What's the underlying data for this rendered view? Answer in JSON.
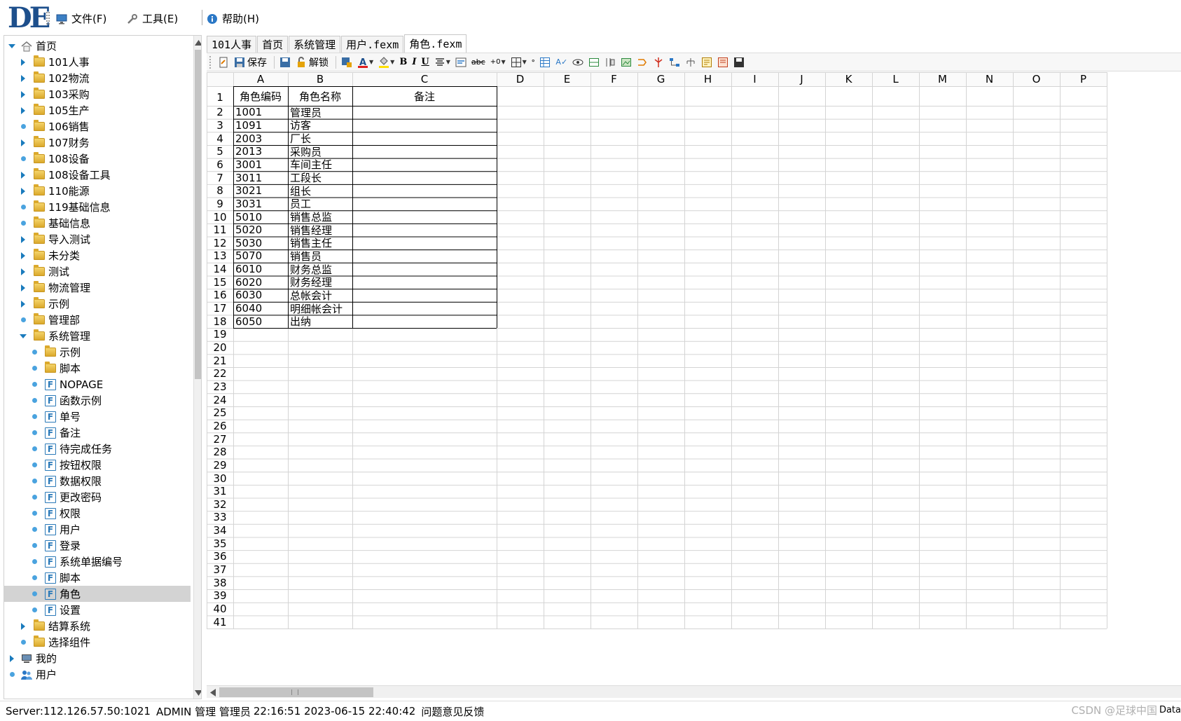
{
  "app": {
    "logo_text": "DE",
    "menu": [
      {
        "label": "文件(F)",
        "icon": "monitor-icon"
      },
      {
        "label": "工具(E)",
        "icon": "wrench-icon"
      },
      {
        "label": "帮助(H)",
        "icon": "info-icon"
      }
    ]
  },
  "tree": {
    "items": [
      {
        "label": "首页",
        "depth": 0,
        "toggle": "expanded",
        "icon": "home-icon"
      },
      {
        "label": "101人事",
        "depth": 1,
        "toggle": "collapsed",
        "icon": "folder-icon"
      },
      {
        "label": "102物流",
        "depth": 1,
        "toggle": "collapsed",
        "icon": "folder-icon"
      },
      {
        "label": "103采购",
        "depth": 1,
        "toggle": "collapsed",
        "icon": "folder-icon"
      },
      {
        "label": "105生产",
        "depth": 1,
        "toggle": "collapsed",
        "icon": "folder-icon"
      },
      {
        "label": "106销售",
        "depth": 1,
        "toggle": "leaf",
        "icon": "folder-icon"
      },
      {
        "label": "107财务",
        "depth": 1,
        "toggle": "collapsed",
        "icon": "folder-icon"
      },
      {
        "label": "108设备",
        "depth": 1,
        "toggle": "leaf",
        "icon": "folder-icon"
      },
      {
        "label": "108设备工具",
        "depth": 1,
        "toggle": "collapsed",
        "icon": "folder-icon"
      },
      {
        "label": "110能源",
        "depth": 1,
        "toggle": "collapsed",
        "icon": "folder-icon"
      },
      {
        "label": "119基础信息",
        "depth": 1,
        "toggle": "leaf",
        "icon": "folder-icon"
      },
      {
        "label": "基础信息",
        "depth": 1,
        "toggle": "leaf",
        "icon": "folder-icon"
      },
      {
        "label": "导入测试",
        "depth": 1,
        "toggle": "collapsed",
        "icon": "folder-icon"
      },
      {
        "label": "未分类",
        "depth": 1,
        "toggle": "collapsed",
        "icon": "folder-icon"
      },
      {
        "label": "测试",
        "depth": 1,
        "toggle": "collapsed",
        "icon": "folder-icon"
      },
      {
        "label": "物流管理",
        "depth": 1,
        "toggle": "collapsed",
        "icon": "folder-icon"
      },
      {
        "label": "示例",
        "depth": 1,
        "toggle": "collapsed",
        "icon": "folder-icon"
      },
      {
        "label": "管理部",
        "depth": 1,
        "toggle": "leaf",
        "icon": "folder-icon"
      },
      {
        "label": "系统管理",
        "depth": 1,
        "toggle": "expanded",
        "icon": "folder-icon"
      },
      {
        "label": "示例",
        "depth": 2,
        "toggle": "leaf",
        "icon": "folder-icon"
      },
      {
        "label": "脚本",
        "depth": 2,
        "toggle": "leaf",
        "icon": "folder-icon"
      },
      {
        "label": "NOPAGE",
        "depth": 2,
        "toggle": "leaf",
        "icon": "form-icon"
      },
      {
        "label": "函数示例",
        "depth": 2,
        "toggle": "leaf",
        "icon": "form-icon"
      },
      {
        "label": "单号",
        "depth": 2,
        "toggle": "leaf",
        "icon": "form-icon"
      },
      {
        "label": "备注",
        "depth": 2,
        "toggle": "leaf",
        "icon": "form-icon"
      },
      {
        "label": "待完成任务",
        "depth": 2,
        "toggle": "leaf",
        "icon": "form-icon"
      },
      {
        "label": "按钮权限",
        "depth": 2,
        "toggle": "leaf",
        "icon": "form-icon"
      },
      {
        "label": "数据权限",
        "depth": 2,
        "toggle": "leaf",
        "icon": "form-icon"
      },
      {
        "label": "更改密码",
        "depth": 2,
        "toggle": "leaf",
        "icon": "form-icon"
      },
      {
        "label": "权限",
        "depth": 2,
        "toggle": "leaf",
        "icon": "form-icon"
      },
      {
        "label": "用户",
        "depth": 2,
        "toggle": "leaf",
        "icon": "form-icon"
      },
      {
        "label": "登录",
        "depth": 2,
        "toggle": "leaf",
        "icon": "form-icon"
      },
      {
        "label": "系统单据编号",
        "depth": 2,
        "toggle": "leaf",
        "icon": "form-icon"
      },
      {
        "label": "脚本",
        "depth": 2,
        "toggle": "leaf",
        "icon": "form-icon"
      },
      {
        "label": "角色",
        "depth": 2,
        "toggle": "leaf",
        "icon": "form-icon",
        "selected": true
      },
      {
        "label": "设置",
        "depth": 2,
        "toggle": "leaf",
        "icon": "form-icon"
      },
      {
        "label": "结算系统",
        "depth": 1,
        "toggle": "collapsed",
        "icon": "folder-icon"
      },
      {
        "label": "选择组件",
        "depth": 1,
        "toggle": "leaf",
        "icon": "folder-icon"
      },
      {
        "label": "我的",
        "depth": 0,
        "toggle": "collapsed",
        "icon": "computer-icon"
      },
      {
        "label": "用户",
        "depth": 0,
        "toggle": "leaf",
        "icon": "users-icon"
      }
    ]
  },
  "tabs": [
    {
      "label": "101人事",
      "active": false
    },
    {
      "label": "首页",
      "active": false
    },
    {
      "label": "系统管理",
      "active": false
    },
    {
      "label": "用户.fexm",
      "active": false
    },
    {
      "label": "角色.fexm",
      "active": true
    }
  ],
  "toolbar": {
    "save_label": "保存",
    "unlock_label": "解锁"
  },
  "sheet": {
    "columns": [
      "A",
      "B",
      "C",
      "D",
      "E",
      "F",
      "G",
      "H",
      "I",
      "J",
      "K",
      "L",
      "M",
      "N",
      "O",
      "P"
    ],
    "row_count": 41,
    "header_row": [
      "角色编码",
      "角色名称",
      "备注"
    ],
    "rows": [
      [
        "1001",
        "管理员",
        ""
      ],
      [
        "1091",
        "访客",
        ""
      ],
      [
        "2003",
        "厂长",
        ""
      ],
      [
        "2013",
        "采购员",
        ""
      ],
      [
        "3001",
        "车间主任",
        ""
      ],
      [
        "3011",
        "工段长",
        ""
      ],
      [
        "3021",
        "组长",
        ""
      ],
      [
        "3031",
        "员工",
        ""
      ],
      [
        "5010",
        "销售总监",
        ""
      ],
      [
        "5020",
        "销售经理",
        ""
      ],
      [
        "5030",
        "销售主任",
        ""
      ],
      [
        "5070",
        "销售员",
        ""
      ],
      [
        "6010",
        "财务总监",
        ""
      ],
      [
        "6020",
        "财务经理",
        ""
      ],
      [
        "6030",
        "总帐会计",
        ""
      ],
      [
        "6040",
        "明细帐会计",
        ""
      ],
      [
        "6050",
        "出纳",
        ""
      ]
    ]
  },
  "status": {
    "server": "Server:112.126.57.50:1021",
    "user": "ADMIN 管理 管理员",
    "time": "22:16:51 2023-06-15 22:40:42",
    "feedback": "问题意见反馈",
    "right_text": "Data",
    "watermark": "CSDN @足球中国"
  }
}
